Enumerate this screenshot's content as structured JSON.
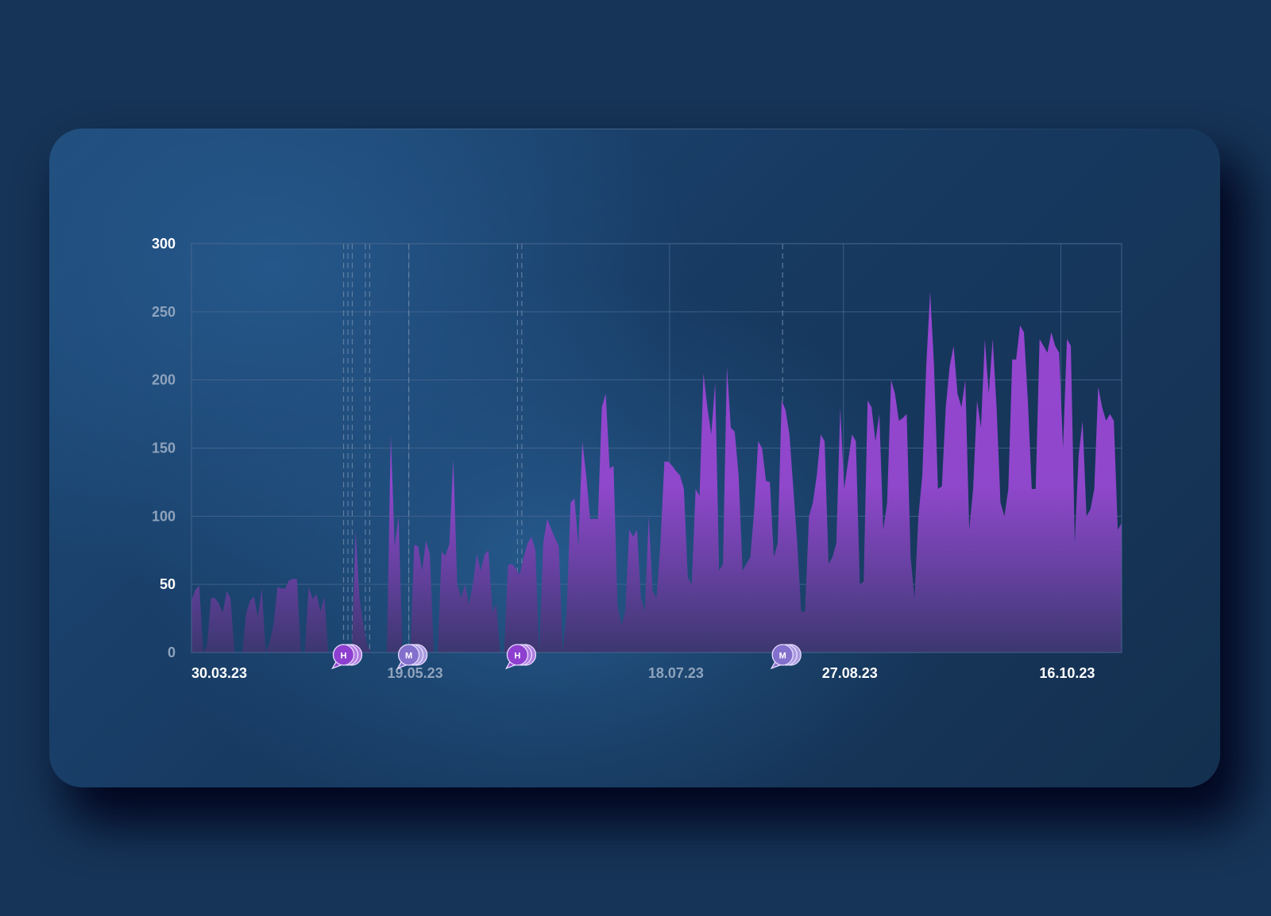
{
  "chart_data": {
    "type": "area",
    "title": "",
    "xlabel": "",
    "ylabel": "",
    "ylim": [
      0,
      300
    ],
    "yticks": [
      "0",
      "50",
      "100",
      "150",
      "200",
      "250",
      "300"
    ],
    "yticks_highlighted": [
      "50",
      "300"
    ],
    "x_start": "30.03.23",
    "x_end": "30.10.23",
    "xticks": [
      {
        "label": "30.03.23",
        "date": "2023-03-30",
        "highlighted": true
      },
      {
        "label": "19.05.23",
        "date": "2023-05-19",
        "highlighted": false
      },
      {
        "label": "18.07.23",
        "date": "2023-07-18",
        "highlighted": false
      },
      {
        "label": "27.08.23",
        "date": "2023-08-27",
        "highlighted": true
      },
      {
        "label": "16.10.23",
        "date": "2023-10-16",
        "highlighted": true
      }
    ],
    "grid": true,
    "series": [
      {
        "values": [
          38,
          46,
          49,
          0,
          5,
          40,
          40,
          36,
          29,
          45,
          40,
          0,
          0,
          0,
          29,
          38,
          41,
          26,
          47,
          0,
          7,
          20,
          48,
          47,
          47,
          53,
          54,
          54,
          0,
          0,
          48,
          39,
          43,
          30,
          41,
          0,
          0,
          0,
          0,
          0,
          0,
          0,
          89,
          40,
          20,
          5,
          0,
          0,
          0,
          0,
          0,
          160,
          78,
          100,
          0,
          0,
          0,
          79,
          78,
          60,
          82,
          72,
          0,
          0,
          74,
          71,
          80,
          142,
          50,
          40,
          50,
          35,
          50,
          72,
          60,
          72,
          75,
          30,
          35,
          0,
          0,
          64,
          65,
          62,
          57,
          70,
          80,
          85,
          75,
          0,
          80,
          98,
          91,
          84,
          78,
          0,
          30,
          110,
          113,
          78,
          155,
          130,
          98,
          98,
          98,
          180,
          190,
          135,
          137,
          35,
          20,
          30,
          90,
          85,
          90,
          40,
          30,
          100,
          45,
          40,
          80,
          140,
          140,
          137,
          133,
          130,
          120,
          55,
          50,
          120,
          115,
          205,
          180,
          160,
          198,
          60,
          65,
          210,
          165,
          162,
          130,
          60,
          65,
          70,
          105,
          155,
          150,
          126,
          125,
          70,
          80,
          185,
          178,
          160,
          120,
          80,
          30,
          30,
          100,
          110,
          130,
          160,
          155,
          65,
          70,
          80,
          180,
          120,
          140,
          160,
          155,
          50,
          52,
          185,
          180,
          155,
          175,
          90,
          110,
          200,
          190,
          170,
          172,
          175,
          70,
          40,
          100,
          130,
          210,
          265,
          210,
          120,
          122,
          180,
          210,
          225,
          190,
          180,
          200,
          90,
          120,
          185,
          165,
          230,
          190,
          230,
          180,
          110,
          100,
          120,
          215,
          215,
          240,
          235,
          185,
          120,
          120,
          230,
          225,
          220,
          235,
          225,
          220,
          150,
          230,
          225,
          80,
          145,
          170,
          100,
          105,
          120,
          195,
          180,
          170,
          175,
          170,
          90,
          95
        ]
      }
    ],
    "annotations": [
      {
        "label": "H",
        "date": "2023-05-04",
        "style": "purple"
      },
      {
        "label": "M",
        "date": "2023-05-19",
        "style": "lavender"
      },
      {
        "label": "H",
        "date": "2023-06-13",
        "style": "purple"
      },
      {
        "label": "M",
        "date": "2023-08-13",
        "style": "lavender"
      }
    ],
    "event_lines": [
      "2023-05-04",
      "2023-05-05",
      "2023-05-06",
      "2023-05-09",
      "2023-05-10",
      "2023-05-19",
      "2023-06-13",
      "2023-06-14",
      "2023-08-13"
    ],
    "colors": {
      "area_top": "#9b45d4",
      "area_bottom": "#3d3874",
      "grid": "#4a6a92",
      "tick_text": "#8ea3bd",
      "tick_text_highlight": "#ffffff",
      "pin_purple": "#8e3fcf",
      "pin_lavender": "#8270cc"
    }
  }
}
